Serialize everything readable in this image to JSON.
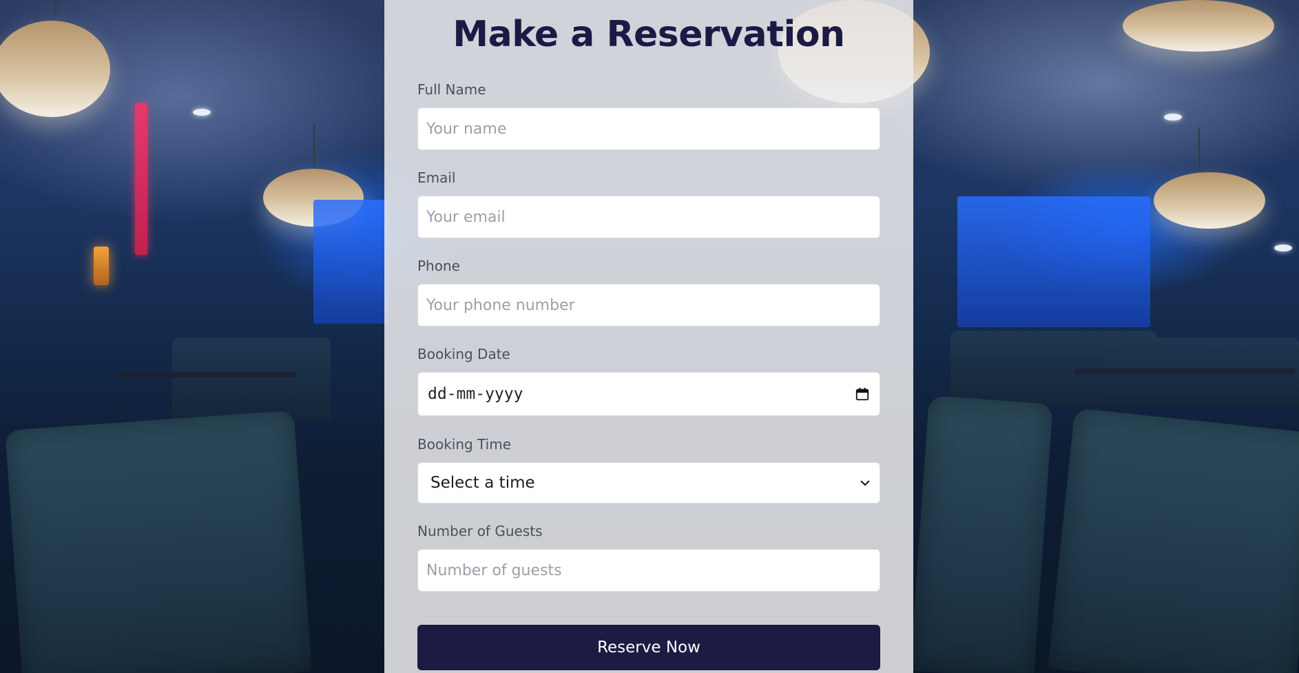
{
  "form": {
    "title": "Make a Reservation",
    "fields": {
      "full_name": {
        "label": "Full Name",
        "placeholder": "Your name",
        "value": ""
      },
      "email": {
        "label": "Email",
        "placeholder": "Your email",
        "value": ""
      },
      "phone": {
        "label": "Phone",
        "placeholder": "Your phone number",
        "value": ""
      },
      "booking_date": {
        "label": "Booking Date",
        "display_value": "dd-mm-yyyy",
        "icon": "calendar-icon"
      },
      "booking_time": {
        "label": "Booking Time",
        "selected_option": "Select a time",
        "icon": "chevron-down-icon"
      },
      "guests": {
        "label": "Number of Guests",
        "placeholder": "Number of guests",
        "value": ""
      }
    },
    "submit_label": "Reserve Now"
  },
  "colors": {
    "title": "#1b1a45",
    "button_bg": "#1c1b44",
    "button_text": "#ffffff",
    "card_bg": "#ececee"
  }
}
